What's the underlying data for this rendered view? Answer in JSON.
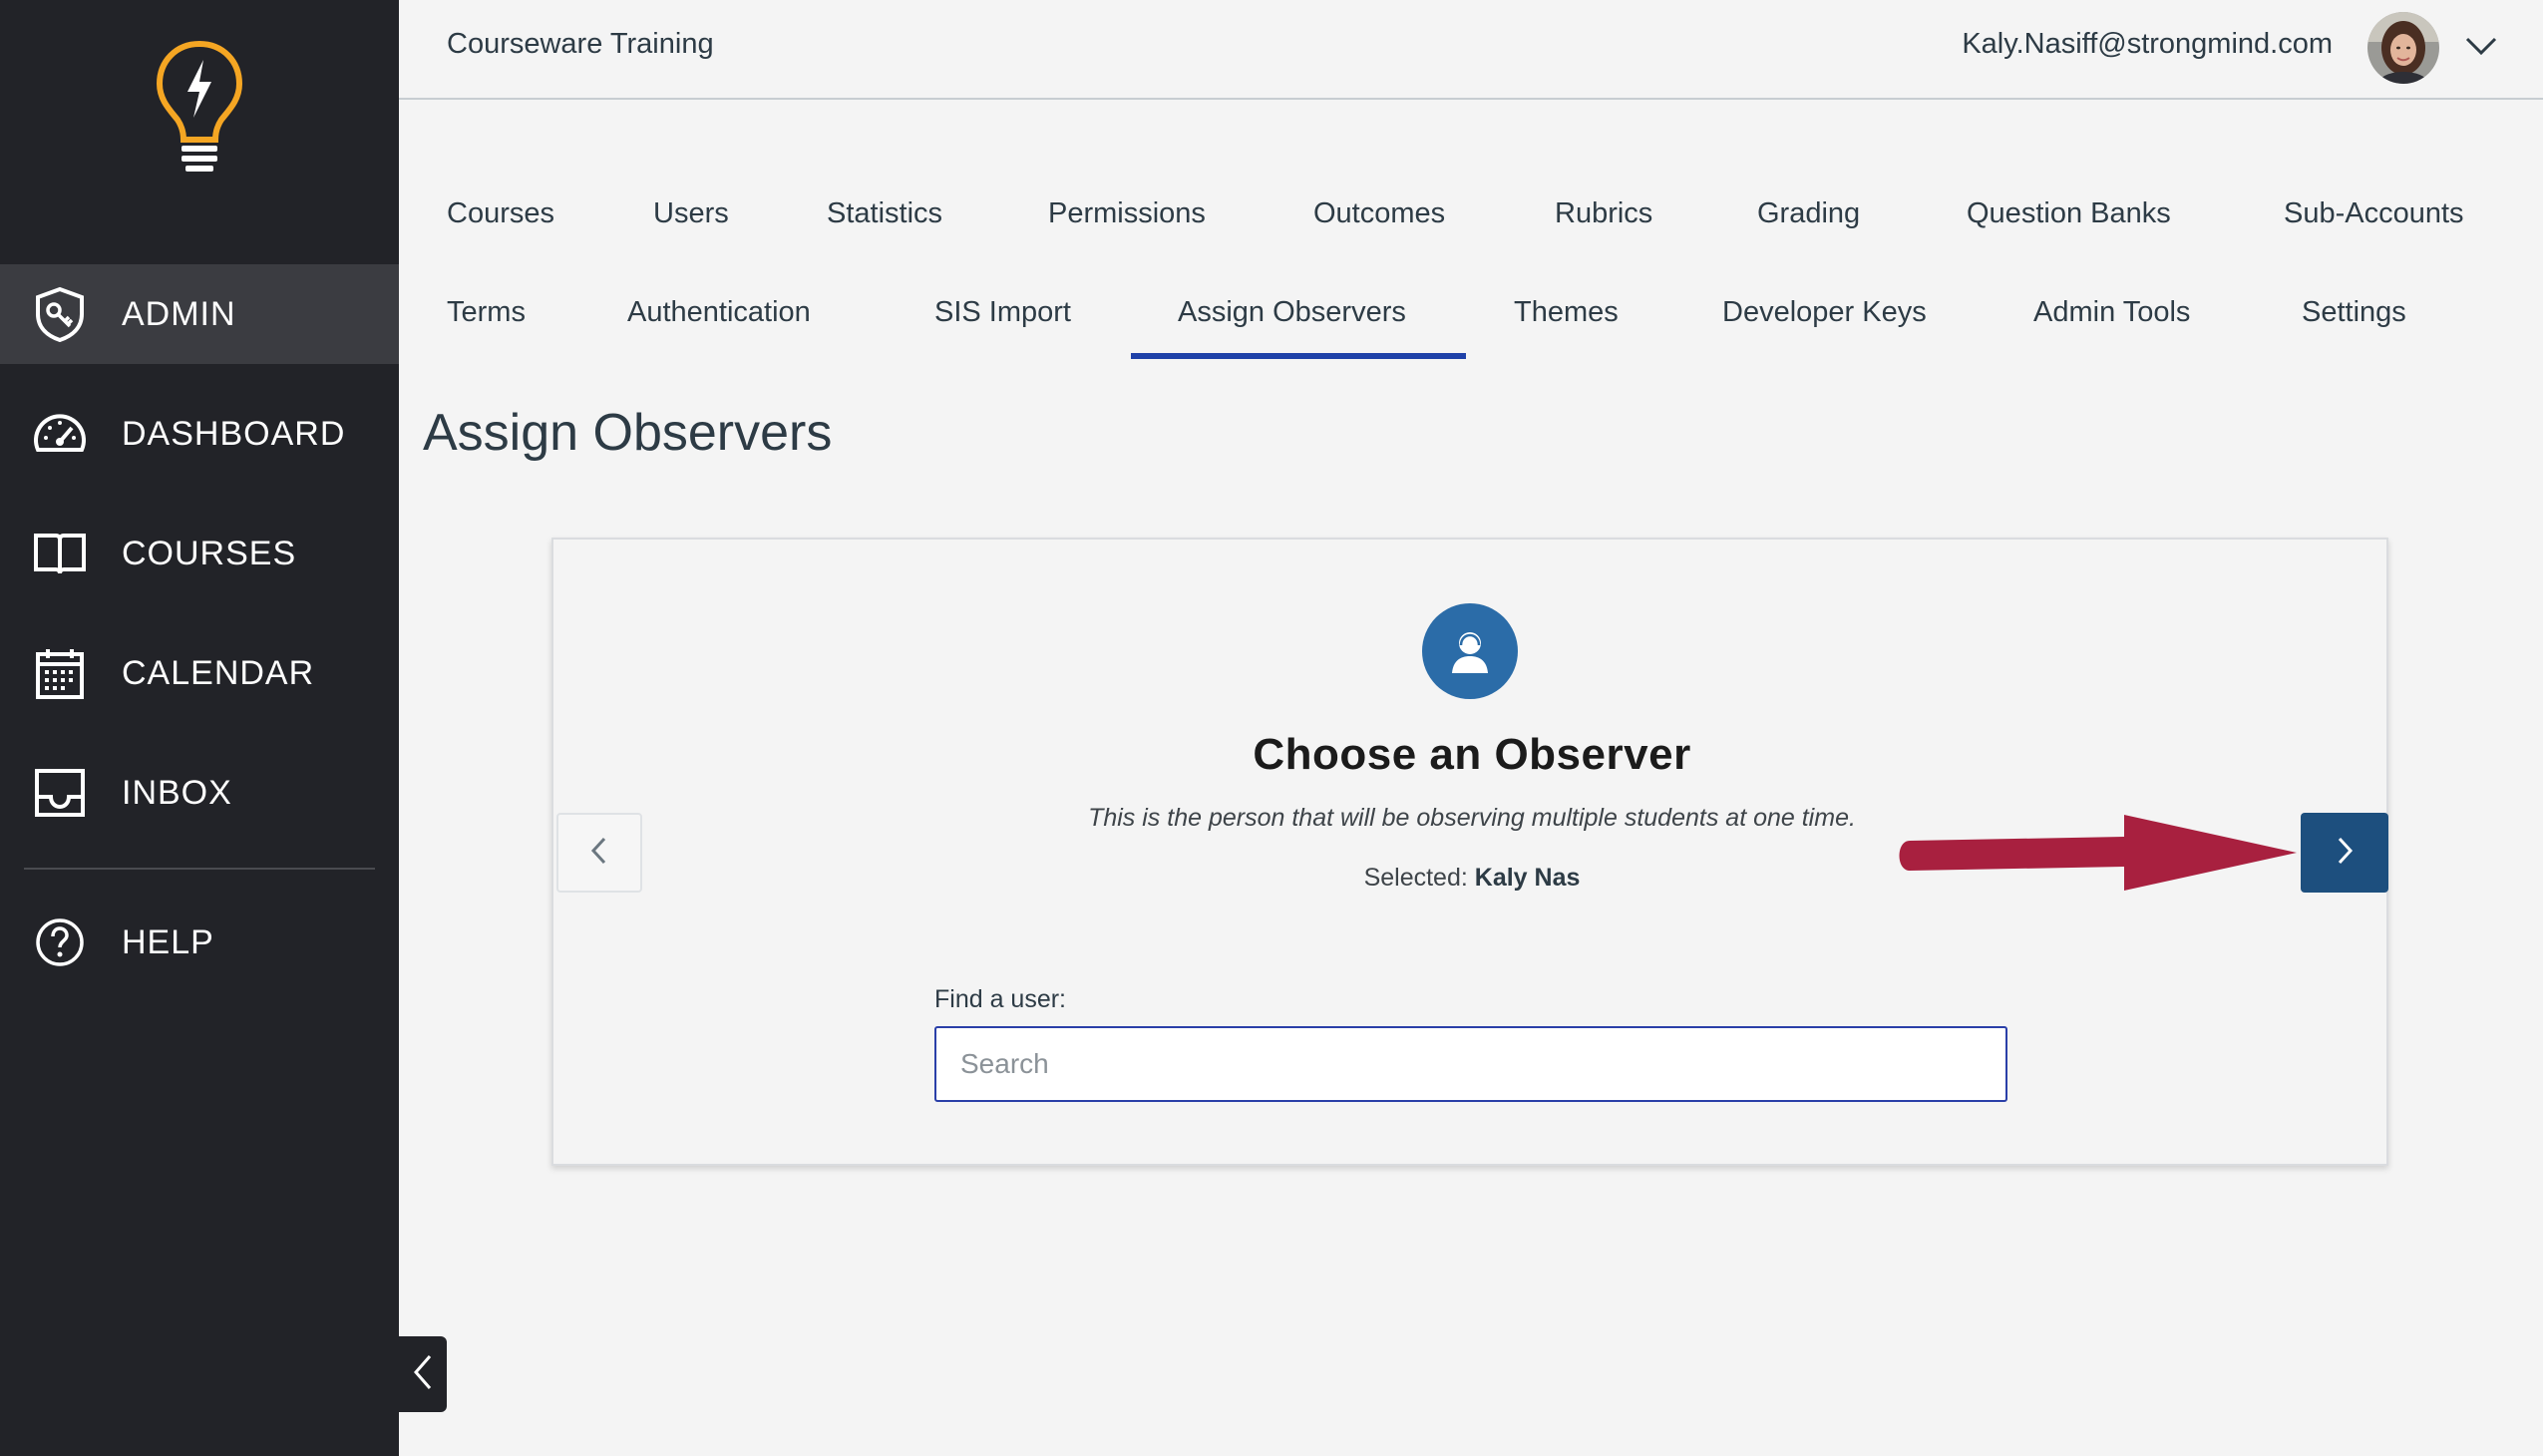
{
  "header": {
    "account_name": "Courseware Training",
    "user_email": "Kaly.Nasiff@strongmind.com"
  },
  "sidebar": {
    "items": [
      {
        "label": "ADMIN",
        "icon": "admin-shield-icon",
        "active": true
      },
      {
        "label": "DASHBOARD",
        "icon": "dashboard-gauge-icon"
      },
      {
        "label": "COURSES",
        "icon": "book-icon"
      },
      {
        "label": "CALENDAR",
        "icon": "calendar-icon"
      },
      {
        "label": "INBOX",
        "icon": "inbox-icon"
      },
      {
        "label": "HELP",
        "icon": "help-icon"
      }
    ]
  },
  "tabs": {
    "row1": [
      "Courses",
      "Users",
      "Statistics",
      "Permissions",
      "Outcomes",
      "Rubrics",
      "Grading",
      "Question Banks",
      "Sub-Accounts"
    ],
    "row2": [
      "Terms",
      "Authentication",
      "SIS Import",
      "Assign Observers",
      "Themes",
      "Developer Keys",
      "Admin Tools",
      "Settings"
    ],
    "active": "Assign Observers"
  },
  "page": {
    "title": "Assign Observers"
  },
  "card": {
    "step_title": "Choose an Observer",
    "step_description": "This is the person that will be observing multiple students at one time.",
    "selected_label": "Selected:",
    "selected_value": "Kaly Nas",
    "find_label": "Find a user:",
    "search_placeholder": "Search",
    "search_value": ""
  },
  "colors": {
    "sidebar_bg": "#222328",
    "sidebar_active": "#3b3c41",
    "tab_underline": "#1e41a8",
    "next_button": "#1d4f7e",
    "observer_icon_bg": "#2b6ca8",
    "annotation_arrow": "#a8203f",
    "logo": "#f5a623"
  }
}
